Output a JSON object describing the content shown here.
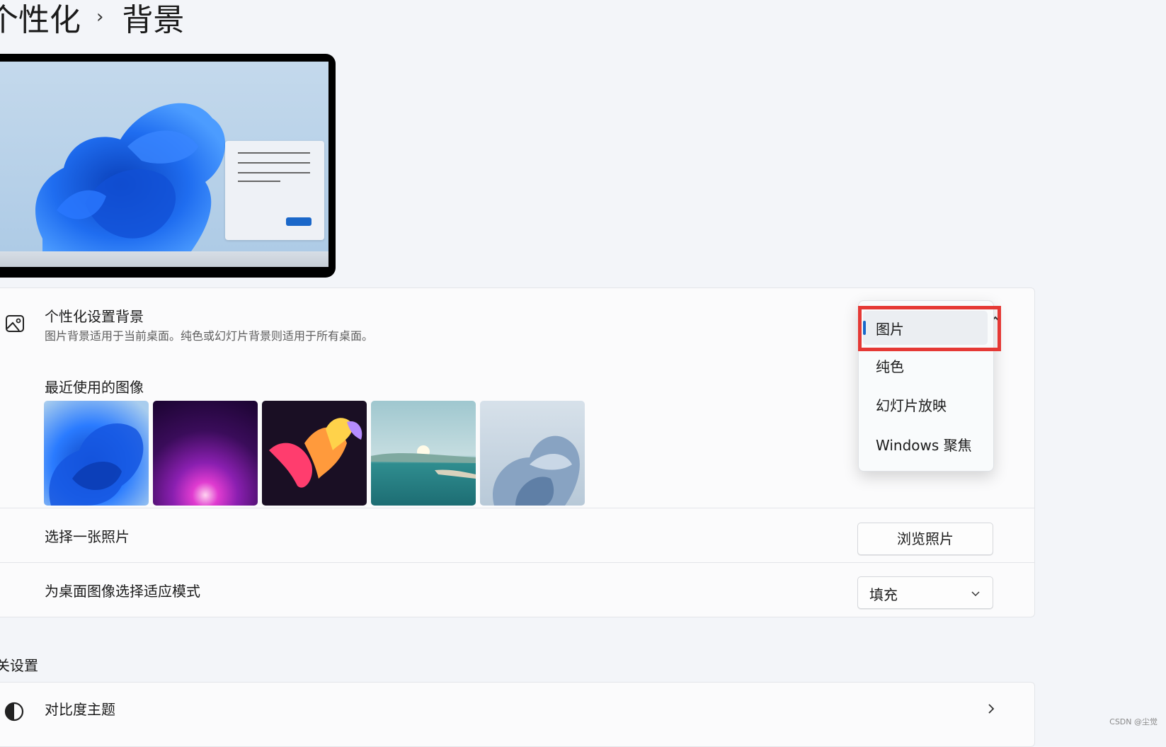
{
  "breadcrumb": {
    "parent": "个性化",
    "separator": "›",
    "current": "背景"
  },
  "personalize_row": {
    "title": "个性化设置背景",
    "subtitle": "图片背景适用于当前桌面。纯色或幻灯片背景则适用于所有桌面。"
  },
  "recent": {
    "title": "最近使用的图像"
  },
  "dropdown_options": [
    "图片",
    "纯色",
    "幻灯片放映",
    "Windows 聚焦"
  ],
  "choose_photo": {
    "label": "选择一张照片",
    "button": "浏览照片"
  },
  "fit_mode": {
    "label": "为桌面图像选择适应模式",
    "value": "填充"
  },
  "related": {
    "section_title": "关设置",
    "contrast_title": "对比度主题"
  },
  "watermark": "CSDN @尘觉",
  "colors": {
    "accent": "#1a67c9",
    "highlight_box": "#e53935"
  }
}
